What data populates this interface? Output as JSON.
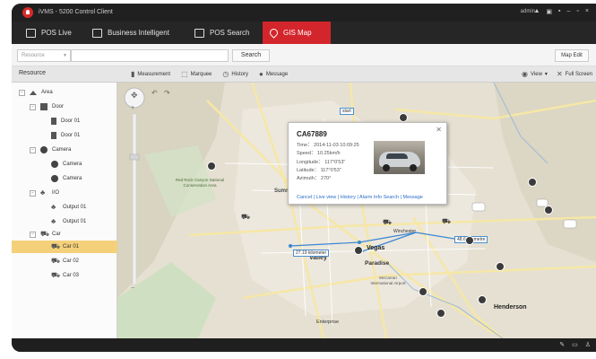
{
  "window": {
    "title": "iVMS - 5200 Control Client",
    "user": "admin",
    "sys_icons": [
      "▲",
      "▣",
      "▪",
      "–",
      "▫",
      "×"
    ]
  },
  "tabs": [
    {
      "label": "POS Live",
      "icon": "pos-icon"
    },
    {
      "label": "Business Intelligent",
      "icon": "chart-icon"
    },
    {
      "label": "POS Search",
      "icon": "search-doc-icon"
    },
    {
      "label": "GIS Map",
      "icon": "map-pin-icon",
      "active": true
    }
  ],
  "searchbar": {
    "resource_placeholder": "Resource",
    "search_label": "Search",
    "map_edit_label": "Map Edit"
  },
  "toolbar": {
    "resource_label": "Resource",
    "measurement": "Measurement",
    "marquee": "Marquee",
    "history": "History",
    "message": "Message",
    "view": "View",
    "full_screen": "Full Screen"
  },
  "tree": {
    "area": "Area",
    "door": "Door",
    "door_01a": "Door 01",
    "door_01b": "Door 01",
    "camera_group": "Camera",
    "camera_1": "Camera",
    "camera_2": "Camera",
    "io": "I/O",
    "output_1": "Output 01",
    "output_2": "Output 01",
    "car": "Car",
    "car_01": "Car 01",
    "car_02": "Car 02",
    "car_03": "Car 03"
  },
  "popup": {
    "plate": "CA67889",
    "time": "Time： 2014-11-03  10:09:25",
    "speed": "Speed： 10.25km/h",
    "longitude": "Longitude： 117°0'53\"",
    "latitude": "Latitude： 117°0'53\"",
    "azimuth": "Azimuth： 270°",
    "links": "Cancel | Live view | History | Alarm Info Search | Message"
  },
  "map": {
    "labels": {
      "summit": "Summit",
      "vegas": "Vegas",
      "paradise": "Paradise",
      "henderson": "Henderson",
      "winchester": "Winchester",
      "valley": "Valley",
      "enterprise": "Enterprise",
      "start": "start",
      "redrock": "Red Rock Canyon National Conservation Area",
      "mccarran": "McCarran International Airport"
    },
    "measure_1": "27.19 kilometer",
    "measure_2": "48.6 kilometre"
  },
  "colors": {
    "accent": "#d3262c",
    "selected_row": "#f5d07a",
    "link": "#2b6fc7",
    "road": "#f6e7a6"
  }
}
